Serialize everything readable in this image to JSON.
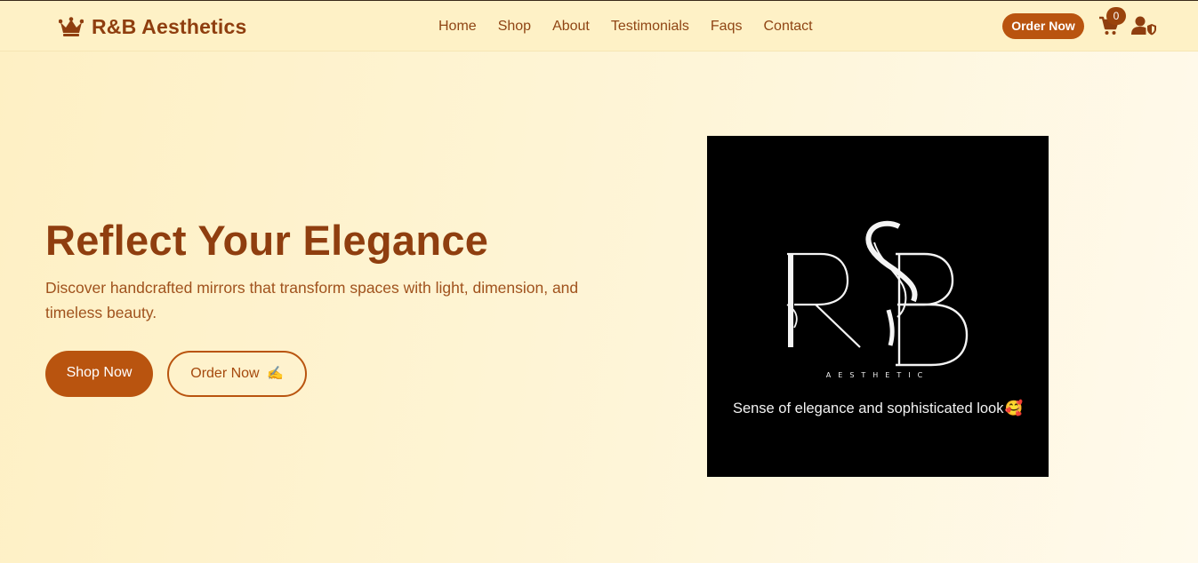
{
  "brand": {
    "name": "R&B Aesthetics",
    "icon": "crown-icon"
  },
  "nav": {
    "items": [
      "Home",
      "Shop",
      "About",
      "Testimonials",
      "Faqs",
      "Contact"
    ]
  },
  "header_actions": {
    "order_label": "Order Now",
    "cart_count": "0",
    "cart_icon": "cart-icon",
    "user_icon": "user-shield-icon"
  },
  "hero": {
    "title": "Reflect Your Elegance",
    "description": "Discover handcrafted mirrors that transform spaces with light, dimension, and timeless beauty.",
    "shop_label": "Shop Now",
    "order_label": "Order Now",
    "order_emoji": "✍️"
  },
  "logo_card": {
    "logo_text": "R&B",
    "logo_subtext": "AESTHETIC",
    "tagline": "Sense of elegance and sophisticated look",
    "tagline_emoji": "🥰"
  },
  "colors": {
    "accent": "#b9540f",
    "brand_text": "#8f3e0f",
    "background": "#fef1c6"
  }
}
